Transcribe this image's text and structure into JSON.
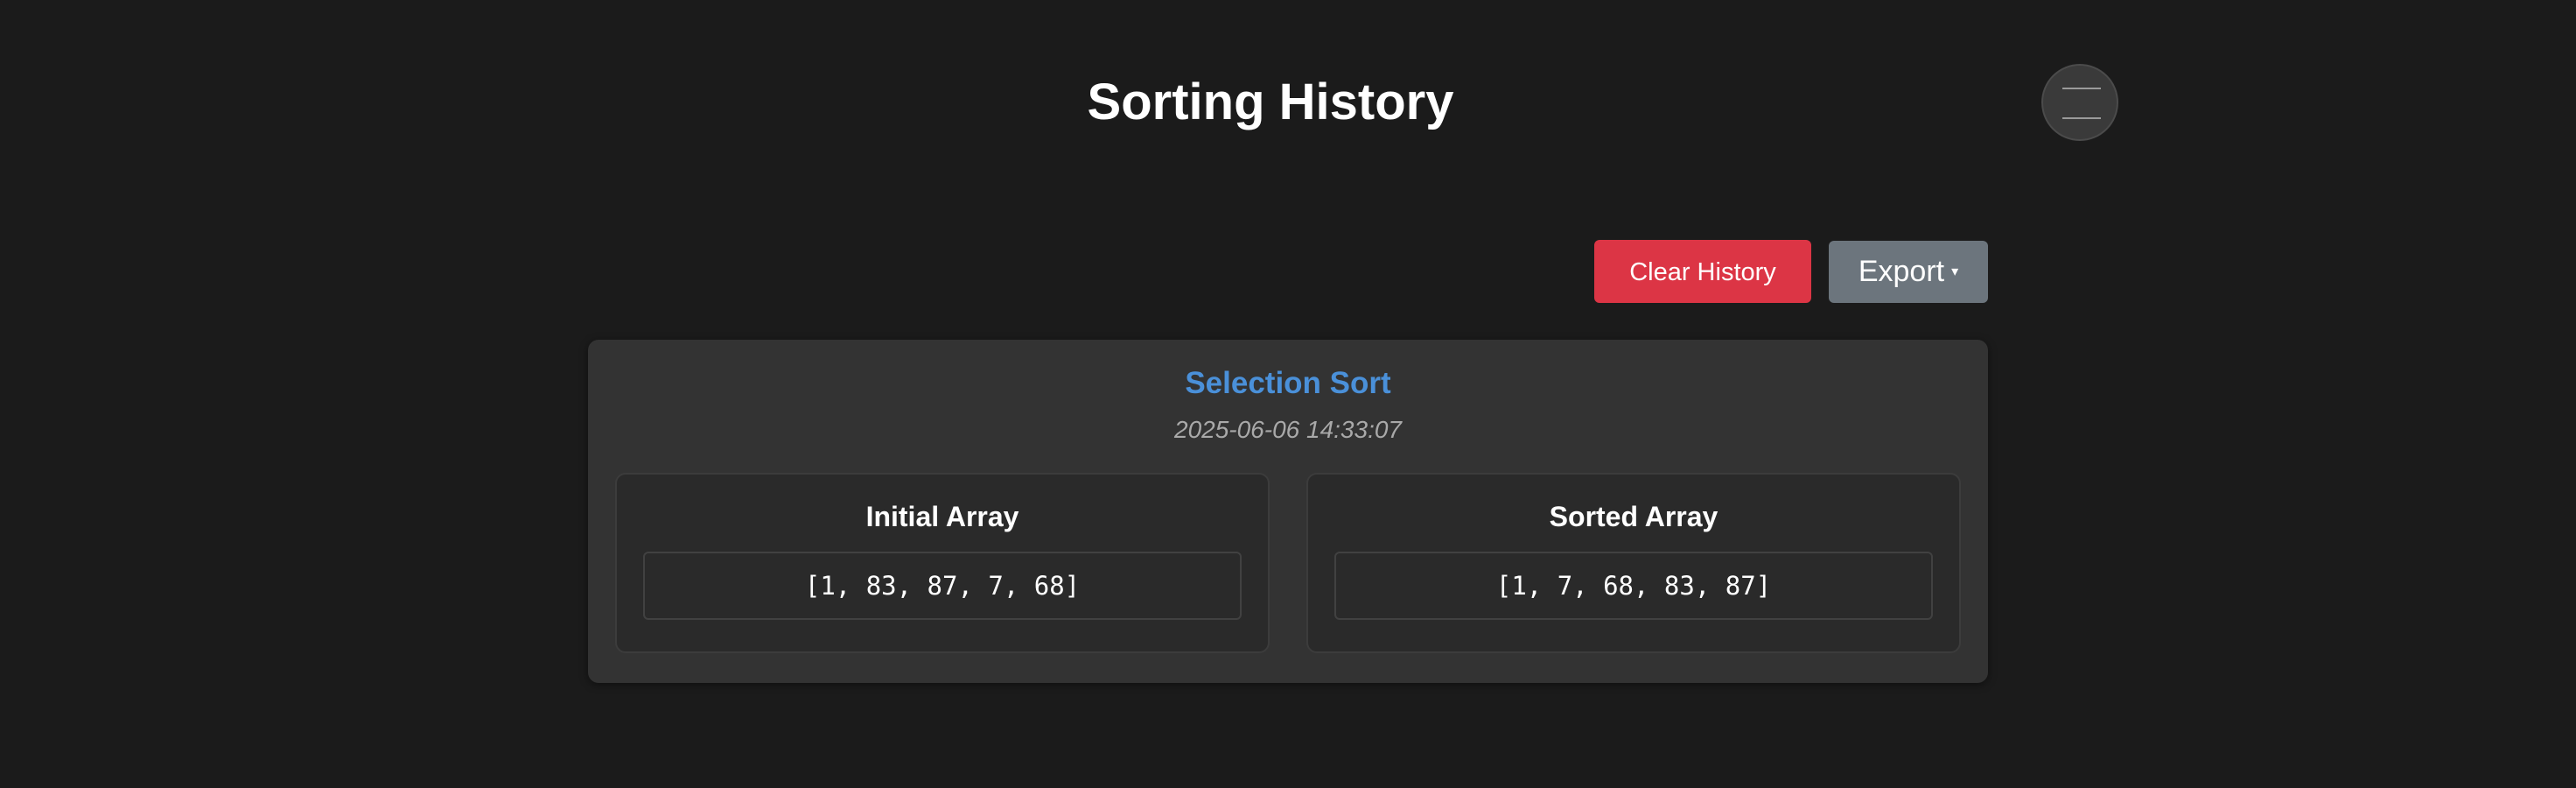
{
  "header": {
    "title": "Sorting History",
    "menu_icon": "hamburger-icon"
  },
  "toolbar": {
    "clear_label": "Clear History",
    "export_label": "Export",
    "export_caret": "▾",
    "clear_color": "#dc3545",
    "export_color": "#6c757d"
  },
  "history": {
    "entries": [
      {
        "algorithm": "Selection Sort",
        "algorithm_color": "#4a90d9",
        "timestamp": "2025-06-06 14:33:07",
        "initial_title": "Initial Array",
        "initial_array": "[1, 83, 87, 7, 68]",
        "sorted_title": "Sorted Array",
        "sorted_array": "[1, 7, 68, 83, 87]"
      }
    ]
  },
  "colors": {
    "background": "#1b1b1b",
    "card": "#333333",
    "panel": "#2a2a2a"
  }
}
